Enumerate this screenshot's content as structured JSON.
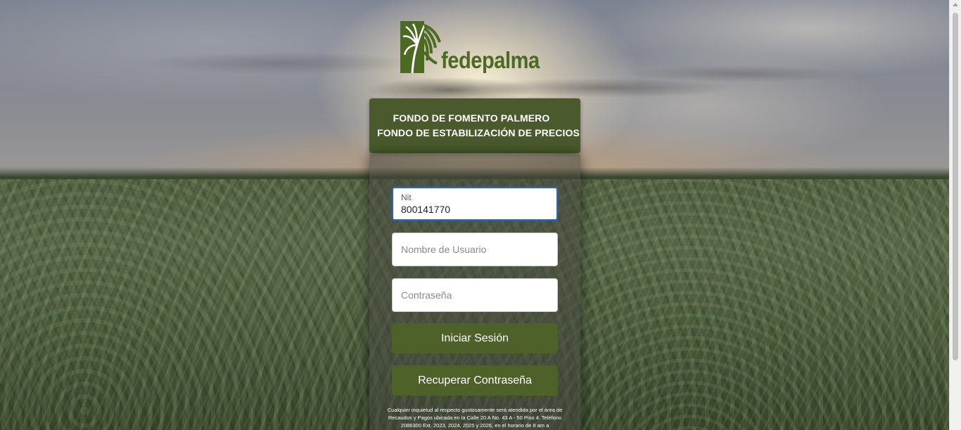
{
  "brand": {
    "name": "fedepalma",
    "color": "#4c6a22"
  },
  "header": {
    "line1": "FONDO DE FOMENTO PALMERO",
    "line2": "FONDO DE ESTABILIZACIÓN DE PRECIOS",
    "background": "#4a5a2c"
  },
  "form": {
    "nit": {
      "label": "Nit",
      "value": "800141770"
    },
    "username": {
      "placeholder": "Nombre de Usuario",
      "value": ""
    },
    "password": {
      "placeholder": "Contraseña",
      "value": ""
    },
    "login_label": "Iniciar Sesión",
    "recover_label": "Recuperar Contraseña",
    "button_color": "#4e6129",
    "focus_color": "#2a64c5"
  },
  "footer": {
    "note": "Cualquier inquietud al respecto gustosamente será atendida por el área de Recaudos y Pagos ubicada en la Calle 20 A No. 43 A - 50 Piso 4. Teléfono 2086300 Ext. 2023, 2024, 2025 y 2026, en el horario de 8 am a"
  },
  "background": {
    "scene": "palm-plantation-sunset"
  }
}
